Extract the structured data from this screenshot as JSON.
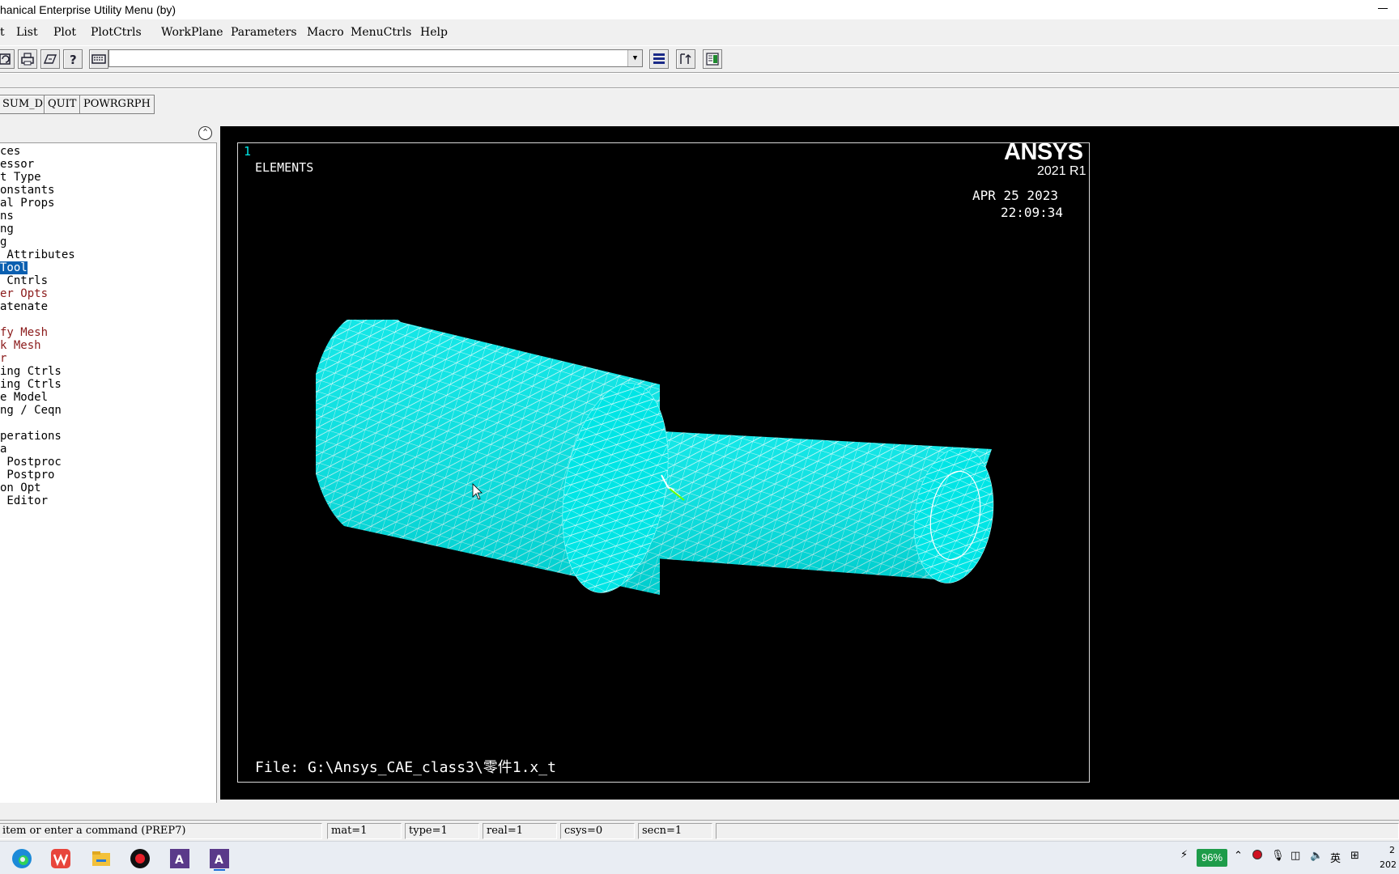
{
  "window": {
    "title": "hanical Enterprise Utility Menu (by)"
  },
  "menu": [
    {
      "label": "t"
    },
    {
      "label": "List"
    },
    {
      "label": "Plot"
    },
    {
      "label": "PlotCtrls"
    },
    {
      "label": "WorkPlane"
    },
    {
      "label": "Parameters"
    },
    {
      "label": "Macro"
    },
    {
      "label": "MenuCtrls"
    },
    {
      "label": "Help"
    }
  ],
  "command": {
    "value": ""
  },
  "quick_buttons": [
    {
      "label": "SUM_DB"
    },
    {
      "label": "QUIT"
    },
    {
      "label": "POWRGRPH"
    }
  ],
  "tree": [
    "ces",
    "essor",
    "t Type",
    "onstants",
    "al Props",
    "ns",
    "ng",
    "g",
    " Attributes",
    "Tool",
    " Cntrls",
    "er Opts",
    "atenate",
    "",
    "fy Mesh",
    "k Mesh",
    "r",
    "ing Ctrls",
    "ing Ctrls",
    "e Model",
    "ng / Ceqn",
    "",
    "perations",
    "a",
    " Postproc",
    " Postpro",
    "on Opt",
    " Editor"
  ],
  "graphics": {
    "window_number": "1",
    "plot_label": "ELEMENTS",
    "brand": "ANSYS",
    "version": "2021 R1",
    "date": "APR 25 2023",
    "time": "22:09:34",
    "file": "File: G:\\Ansys_CAE_class3\\零件1.x_t",
    "mesh_color": "#00e5e5"
  },
  "status": {
    "prompt": "item or enter a command (PREP7)",
    "mat": "mat=1",
    "type": "type=1",
    "real": "real=1",
    "csys": "csys=0",
    "secn": "secn=1"
  },
  "taskbar": {
    "battery": "96%",
    "ime": "英",
    "clock_line1": "2",
    "clock_line2": "202"
  }
}
